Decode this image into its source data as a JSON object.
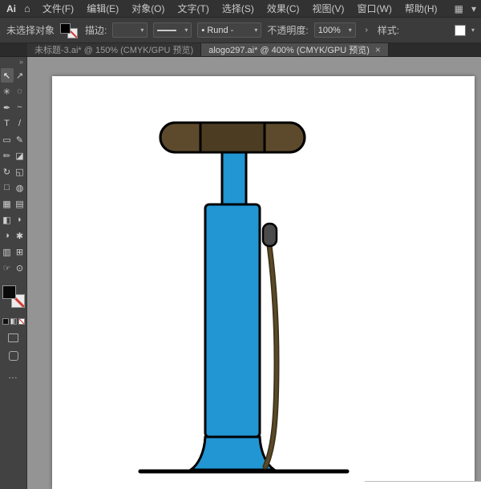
{
  "app": {
    "logo": "Ai",
    "home_icon": "⌂"
  },
  "ui": {
    "chevron": "▾"
  },
  "menu": {
    "items": [
      {
        "id": "file",
        "label": "文件(F)"
      },
      {
        "id": "edit",
        "label": "编辑(E)"
      },
      {
        "id": "object",
        "label": "对象(O)"
      },
      {
        "id": "type",
        "label": "文字(T)"
      },
      {
        "id": "select",
        "label": "选择(S)"
      },
      {
        "id": "effect",
        "label": "效果(C)"
      },
      {
        "id": "view",
        "label": "视图(V)"
      },
      {
        "id": "window",
        "label": "窗口(W)"
      },
      {
        "id": "help",
        "label": "帮助(H)"
      }
    ],
    "right": {
      "workspace_icon": "▦"
    }
  },
  "control_bar": {
    "no_selection": "未选择对象",
    "stroke_label": "描边:",
    "brush_icon": "▪",
    "brush_value": "Rund -",
    "opacity_label": "不透明度:",
    "opacity_value": "100%",
    "more_arrow": "›",
    "style_label": "样式:"
  },
  "tabs": {
    "close_glyph": "×",
    "items": [
      {
        "label": "未标题-3.ai* @ 150% (CMYK/GPU 预览)",
        "active": false
      },
      {
        "label": "alogo297.ai* @ 400% (CMYK/GPU 预览)",
        "active": true
      }
    ]
  },
  "toolbar": {
    "collapse_glyph": "»",
    "more_glyph": "…",
    "tools": [
      {
        "id": "selection-tool",
        "glyph": "↖",
        "active": true
      },
      {
        "id": "direct-selection-tool",
        "glyph": "↗"
      },
      {
        "id": "magic-wand-tool",
        "glyph": "✳"
      },
      {
        "id": "lasso-tool",
        "glyph": "◌"
      },
      {
        "id": "pen-tool",
        "glyph": "✒"
      },
      {
        "id": "curvature-tool",
        "glyph": "~"
      },
      {
        "id": "type-tool",
        "glyph": "T"
      },
      {
        "id": "line-segment-tool",
        "glyph": "/"
      },
      {
        "id": "rectangle-tool",
        "glyph": "▭"
      },
      {
        "id": "paintbrush-tool",
        "glyph": "✎"
      },
      {
        "id": "pencil-tool",
        "glyph": "✏"
      },
      {
        "id": "eraser-tool",
        "glyph": "◪"
      },
      {
        "id": "rotate-tool",
        "glyph": "↻"
      },
      {
        "id": "scale-tool",
        "glyph": "◱"
      },
      {
        "id": "free-transform-tool",
        "glyph": "□"
      },
      {
        "id": "shape-builder-tool",
        "glyph": "◍"
      },
      {
        "id": "perspective-grid-tool",
        "glyph": "▦"
      },
      {
        "id": "mesh-tool",
        "glyph": "▤"
      },
      {
        "id": "gradient-tool",
        "glyph": "◧"
      },
      {
        "id": "eyedropper-tool",
        "glyph": "◗"
      },
      {
        "id": "blend-tool",
        "glyph": "◑"
      },
      {
        "id": "symbol-sprayer-tool",
        "glyph": "✱"
      },
      {
        "id": "column-graph-tool",
        "glyph": "▥"
      },
      {
        "id": "artboard-tool",
        "glyph": "⊞"
      },
      {
        "id": "hand-tool",
        "glyph": "☞"
      },
      {
        "id": "zoom-tool",
        "glyph": "⊙"
      }
    ]
  },
  "artwork": {
    "description": "Blue bicycle floor pump with brown T-handle and olive hose on white artboard",
    "colors": {
      "pump_blue": "#2196d3",
      "outline": "#000000",
      "handle_brown": "#5d4a2c",
      "handle_dark": "#4c3c22",
      "hose_olive": "#5a4a28",
      "hose_dark": "#3e331a",
      "nozzle_gray": "#4b4b4b"
    }
  }
}
